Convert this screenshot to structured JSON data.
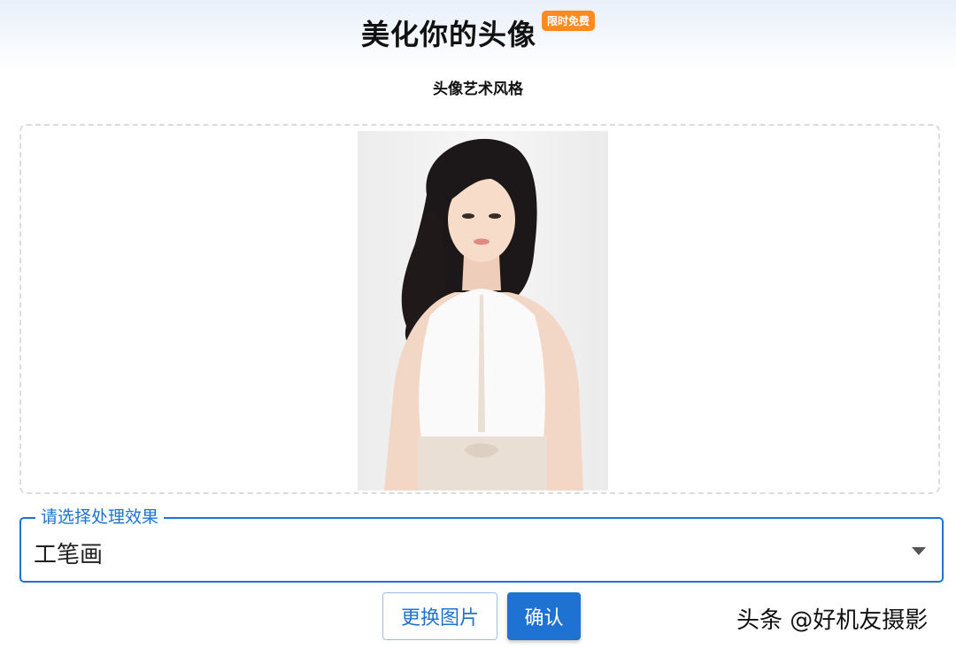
{
  "header": {
    "title": "美化你的头像",
    "badge": "限时免费",
    "subtitle": "头像艺术风格"
  },
  "preview": {
    "image_alt": "portrait photo of a woman in a white halter top"
  },
  "effect_select": {
    "label": "请选择处理效果",
    "value": "工笔画"
  },
  "actions": {
    "change_label": "更换图片",
    "confirm_label": "确认"
  },
  "watermark": "头条 @好机友摄影",
  "colors": {
    "accent": "#1e73d2",
    "badge": "#ff8a1f"
  }
}
